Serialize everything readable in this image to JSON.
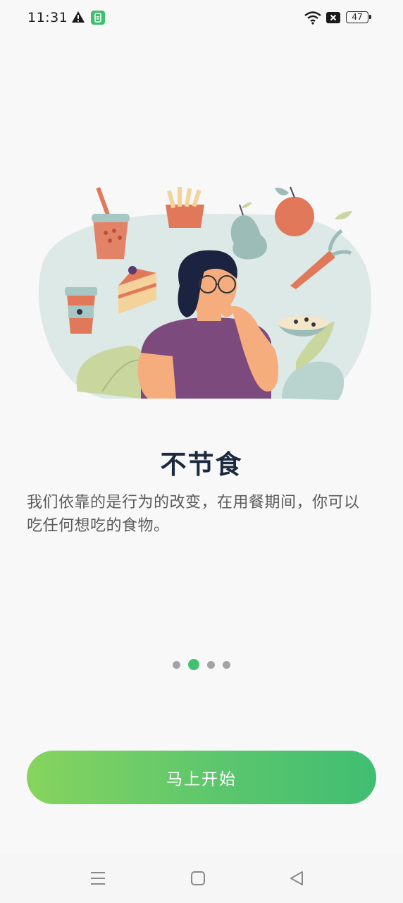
{
  "status_bar": {
    "time": "11:31",
    "battery": "47",
    "icons": [
      "warning-icon",
      "app-notification-icon",
      "wifi-icon",
      "x-icon",
      "battery-icon"
    ]
  },
  "onboarding": {
    "illustration": "woman-thinking-about-food",
    "title": "不节食",
    "description": "我们依靠的是行为的改变，在用餐期间，你可以吃任何想吃的食物。",
    "pager": {
      "total": 4,
      "active_index": 1
    },
    "start_button_label": "马上开始"
  },
  "colors": {
    "accent_green": "#47bf72",
    "button_gradient_start": "#86d45e",
    "button_gradient_end": "#40be72",
    "title": "#1c2a3f"
  },
  "nav_bar": {
    "icons": [
      "menu-icon",
      "home-icon",
      "back-icon"
    ]
  }
}
